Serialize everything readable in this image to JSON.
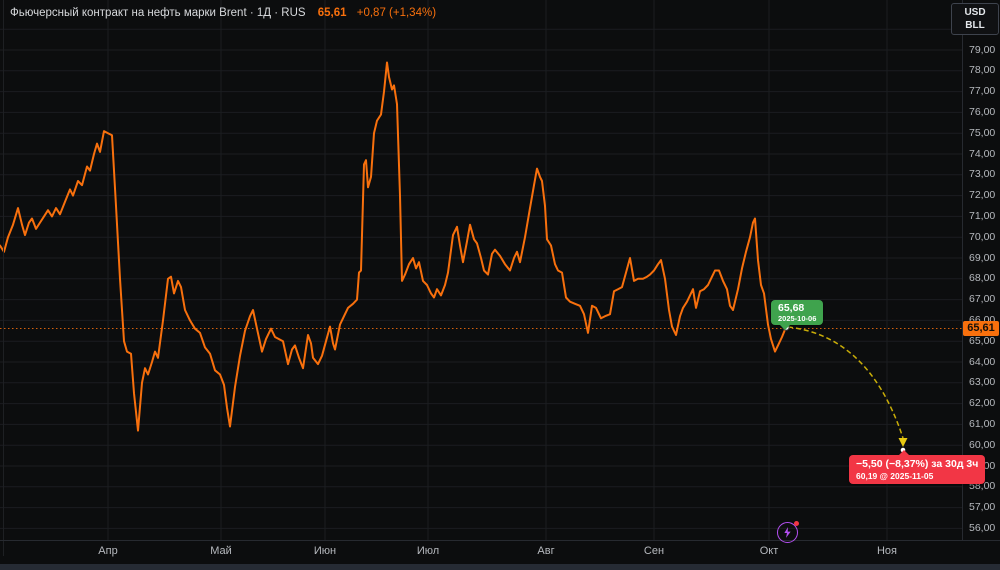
{
  "header": {
    "title": "Фьючерсный контракт на нефть марки Brent · 1Д · RUS",
    "price": "65,61",
    "change": "+0,87 (+1,34%)"
  },
  "units": {
    "currency": "USD",
    "unit": "BLL"
  },
  "price_scale": {
    "badge": "65,61"
  },
  "annotations": {
    "last": {
      "price": "65,68",
      "date": "2025-10-06"
    },
    "forecast": {
      "line1": "−5,50 (−8,37%) за 30д 3ч",
      "line2": "60,19 @ 2025-11-05"
    }
  },
  "colors": {
    "background": "#0c0d0e",
    "grid": "#1b1d20",
    "line": "#f8700d",
    "axis_text": "#b6b9be",
    "green_label": "#3fa34d",
    "red_label": "#f23645",
    "badge_bg": "#f8700d",
    "arrow": "#c9ad08",
    "event_icon": "#b44ff2"
  },
  "chart_data": {
    "type": "line",
    "title": "Фьючерсный контракт на нефть марки Brent",
    "timeframe": "1Д",
    "exchange": "RUS",
    "unit": "USD/BLL",
    "x_categories": [
      "Апр",
      "Май",
      "Июн",
      "Июл",
      "Авг",
      "Сен",
      "Окт",
      "Ноя"
    ],
    "y_ticks": [
      79,
      78,
      77,
      76,
      75,
      74,
      73,
      72,
      71,
      70,
      69,
      68,
      67,
      66,
      65,
      64,
      63,
      62,
      61,
      60,
      59,
      58,
      57,
      56
    ],
    "ylim": [
      56,
      79
    ],
    "grid": true,
    "current_price": 65.61,
    "last_point": {
      "price": 65.68,
      "date": "2025-10-06"
    },
    "forecast_point": {
      "price": 60.19,
      "date": "2025-11-05",
      "change": "−5,50",
      "change_pct": "−8,37%",
      "horizon": "30д 3ч"
    },
    "series": [
      {
        "name": "Brent",
        "color": "#f8700d",
        "points": [
          [
            0,
            69.6
          ],
          [
            4,
            69.3
          ],
          [
            8,
            70.0
          ],
          [
            13,
            70.6
          ],
          [
            18,
            71.4
          ],
          [
            22,
            70.6
          ],
          [
            25,
            70.1
          ],
          [
            29,
            70.7
          ],
          [
            32,
            70.9
          ],
          [
            36,
            70.4
          ],
          [
            40,
            70.7
          ],
          [
            44,
            71.0
          ],
          [
            48,
            71.3
          ],
          [
            52,
            71.0
          ],
          [
            56,
            71.4
          ],
          [
            60,
            71.1
          ],
          [
            65,
            71.7
          ],
          [
            70,
            72.3
          ],
          [
            73,
            72.0
          ],
          [
            78,
            72.7
          ],
          [
            82,
            72.5
          ],
          [
            87,
            73.4
          ],
          [
            90,
            73.2
          ],
          [
            94,
            74.0
          ],
          [
            97,
            74.5
          ],
          [
            100,
            74.1
          ],
          [
            104,
            75.1
          ],
          [
            108,
            75.0
          ],
          [
            112,
            74.9
          ],
          [
            116,
            71.5
          ],
          [
            120,
            68.0
          ],
          [
            124,
            65.0
          ],
          [
            127,
            64.5
          ],
          [
            131,
            64.4
          ],
          [
            134,
            62.5
          ],
          [
            138,
            60.7
          ],
          [
            142,
            63.0
          ],
          [
            145,
            63.7
          ],
          [
            148,
            63.4
          ],
          [
            152,
            64.0
          ],
          [
            155,
            64.5
          ],
          [
            158,
            64.2
          ],
          [
            163,
            66.0
          ],
          [
            168,
            68.0
          ],
          [
            171,
            68.1
          ],
          [
            174,
            67.3
          ],
          [
            178,
            67.9
          ],
          [
            181,
            67.6
          ],
          [
            185,
            66.5
          ],
          [
            190,
            66.0
          ],
          [
            195,
            65.6
          ],
          [
            200,
            65.4
          ],
          [
            205,
            64.7
          ],
          [
            210,
            64.4
          ],
          [
            215,
            63.6
          ],
          [
            220,
            63.4
          ],
          [
            224,
            62.9
          ],
          [
            227,
            61.8
          ],
          [
            230,
            60.9
          ],
          [
            235,
            62.8
          ],
          [
            240,
            64.3
          ],
          [
            245,
            65.5
          ],
          [
            250,
            66.2
          ],
          [
            253,
            66.5
          ],
          [
            257,
            65.6
          ],
          [
            262,
            64.5
          ],
          [
            266,
            65.1
          ],
          [
            271,
            65.6
          ],
          [
            275,
            65.2
          ],
          [
            283,
            65.0
          ],
          [
            288,
            63.9
          ],
          [
            292,
            64.6
          ],
          [
            295,
            64.8
          ],
          [
            299,
            64.2
          ],
          [
            303,
            63.7
          ],
          [
            308,
            65.3
          ],
          [
            311,
            64.9
          ],
          [
            313,
            64.2
          ],
          [
            318,
            63.9
          ],
          [
            322,
            64.3
          ],
          [
            326,
            65.0
          ],
          [
            330,
            65.7
          ],
          [
            333,
            64.9
          ],
          [
            335,
            64.6
          ],
          [
            340,
            65.8
          ],
          [
            344,
            66.2
          ],
          [
            348,
            66.6
          ],
          [
            353,
            66.8
          ],
          [
            357,
            67.0
          ],
          [
            359,
            68.3
          ],
          [
            361,
            68.4
          ],
          [
            364,
            73.5
          ],
          [
            366,
            73.7
          ],
          [
            368,
            72.4
          ],
          [
            371,
            72.9
          ],
          [
            374,
            75.0
          ],
          [
            377,
            75.6
          ],
          [
            381,
            75.9
          ],
          [
            384,
            77.0
          ],
          [
            387,
            78.4
          ],
          [
            389,
            77.7
          ],
          [
            392,
            77.1
          ],
          [
            394,
            77.3
          ],
          [
            397,
            76.4
          ],
          [
            400,
            72.0
          ],
          [
            402,
            67.9
          ],
          [
            405,
            68.2
          ],
          [
            409,
            68.7
          ],
          [
            413,
            69.0
          ],
          [
            416,
            68.5
          ],
          [
            419,
            68.8
          ],
          [
            423,
            67.9
          ],
          [
            427,
            67.7
          ],
          [
            431,
            67.3
          ],
          [
            434,
            67.1
          ],
          [
            437,
            67.5
          ],
          [
            441,
            67.2
          ],
          [
            445,
            67.7
          ],
          [
            448,
            68.3
          ],
          [
            453,
            70.1
          ],
          [
            457,
            70.5
          ],
          [
            460,
            69.6
          ],
          [
            463,
            68.8
          ],
          [
            467,
            69.8
          ],
          [
            470,
            70.6
          ],
          [
            474,
            69.9
          ],
          [
            477,
            69.7
          ],
          [
            481,
            69.0
          ],
          [
            484,
            68.4
          ],
          [
            488,
            68.2
          ],
          [
            492,
            69.2
          ],
          [
            495,
            69.4
          ],
          [
            500,
            69.1
          ],
          [
            505,
            68.7
          ],
          [
            510,
            68.4
          ],
          [
            514,
            69.0
          ],
          [
            517,
            69.3
          ],
          [
            520,
            68.8
          ],
          [
            525,
            70.0
          ],
          [
            530,
            71.4
          ],
          [
            534,
            72.5
          ],
          [
            537,
            73.3
          ],
          [
            540,
            72.9
          ],
          [
            542,
            72.7
          ],
          [
            545,
            71.5
          ],
          [
            547,
            69.9
          ],
          [
            551,
            69.6
          ],
          [
            555,
            68.7
          ],
          [
            558,
            68.4
          ],
          [
            562,
            68.3
          ],
          [
            566,
            67.1
          ],
          [
            570,
            66.9
          ],
          [
            575,
            66.8
          ],
          [
            580,
            66.7
          ],
          [
            584,
            66.3
          ],
          [
            588,
            65.4
          ],
          [
            592,
            66.7
          ],
          [
            596,
            66.6
          ],
          [
            601,
            66.1
          ],
          [
            605,
            66.2
          ],
          [
            610,
            66.3
          ],
          [
            614,
            67.4
          ],
          [
            618,
            67.5
          ],
          [
            622,
            67.6
          ],
          [
            626,
            68.3
          ],
          [
            630,
            69.0
          ],
          [
            634,
            67.9
          ],
          [
            638,
            68.0
          ],
          [
            643,
            68.0
          ],
          [
            647,
            68.1
          ],
          [
            650,
            68.2
          ],
          [
            654,
            68.4
          ],
          [
            658,
            68.7
          ],
          [
            661,
            68.9
          ],
          [
            665,
            68.0
          ],
          [
            669,
            66.5
          ],
          [
            672,
            65.7
          ],
          [
            676,
            65.3
          ],
          [
            680,
            66.2
          ],
          [
            683,
            66.6
          ],
          [
            687,
            66.9
          ],
          [
            690,
            67.2
          ],
          [
            693,
            67.5
          ],
          [
            696,
            66.6
          ],
          [
            700,
            67.4
          ],
          [
            704,
            67.5
          ],
          [
            708,
            67.7
          ],
          [
            712,
            68.1
          ],
          [
            715,
            68.4
          ],
          [
            719,
            68.4
          ],
          [
            723,
            67.9
          ],
          [
            727,
            67.5
          ],
          [
            730,
            66.7
          ],
          [
            733,
            66.5
          ],
          [
            738,
            67.5
          ],
          [
            742,
            68.5
          ],
          [
            746,
            69.3
          ],
          [
            750,
            70.0
          ],
          [
            753,
            70.7
          ],
          [
            755,
            70.9
          ],
          [
            758,
            68.9
          ],
          [
            761,
            67.7
          ],
          [
            764,
            67.3
          ],
          [
            768,
            65.8
          ],
          [
            771,
            65.1
          ],
          [
            775,
            64.5
          ],
          [
            778,
            64.8
          ],
          [
            782,
            65.2
          ],
          [
            786,
            65.68
          ]
        ]
      }
    ]
  }
}
